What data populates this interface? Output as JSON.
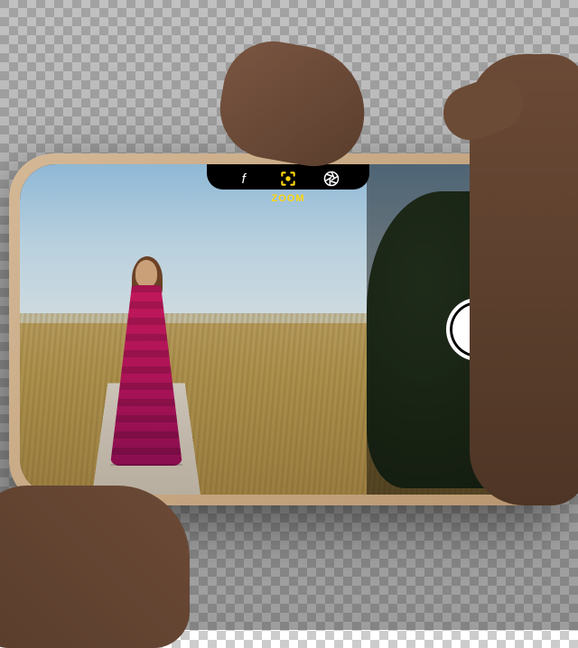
{
  "camera": {
    "mode_label": "ZOOM",
    "controls": {
      "aperture_icon": "f",
      "focus_icon": "focus-brackets",
      "raw_icon": "aperture-ring"
    },
    "active_control": "focus",
    "accent_color": "#ffd60a"
  }
}
